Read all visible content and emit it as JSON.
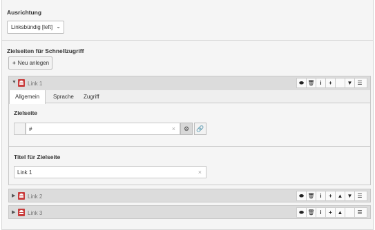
{
  "alignment": {
    "label": "Ausrichtung",
    "select_value": "Linksbündig [left]"
  },
  "targets": {
    "label": "Zielseiten für Schnellzugriff",
    "new_button": "Neu anlegen"
  },
  "items": [
    {
      "title": "Link 1",
      "expanded": true
    },
    {
      "title": "Link 2",
      "expanded": false
    },
    {
      "title": "Link 3",
      "expanded": false
    }
  ],
  "tabs": [
    {
      "label": "Allgemein",
      "active": true
    },
    {
      "label": "Sprache",
      "active": false
    },
    {
      "label": "Zugriff",
      "active": false
    }
  ],
  "fields": {
    "target_label": "Zielseite",
    "target_value": "#",
    "title_label": "Titel für Zielseite",
    "title_value": "Link 1"
  },
  "icons": {
    "expand": "triangle-down-icon",
    "collapsed": "triangle-right-icon",
    "record": "record-icon",
    "toggle": "toggle-icon",
    "delete": "trash-icon",
    "info": "info-icon",
    "add": "plus-icon",
    "up": "arrow-up-icon",
    "down": "arrow-down-icon",
    "drag": "drag-handle-icon",
    "clear": "clear-icon",
    "link_browser": "link-browser-icon",
    "link": "link-icon"
  },
  "colors": {
    "record_red": "#c83c3c",
    "header_gray": "#dcdcdc"
  }
}
